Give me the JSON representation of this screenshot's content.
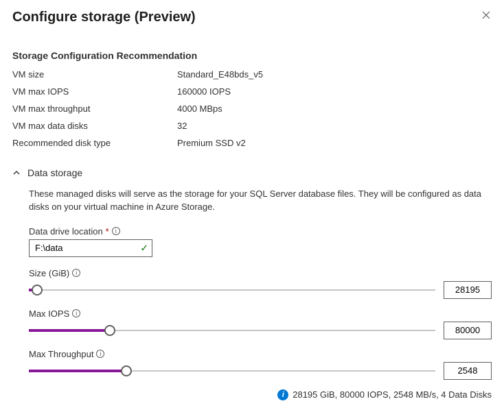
{
  "header": {
    "title": "Configure storage (Preview)"
  },
  "recommendation": {
    "heading": "Storage Configuration Recommendation",
    "rows": {
      "vm_size_label": "VM size",
      "vm_size_value": "Standard_E48bds_v5",
      "vm_max_iops_label": "VM max IOPS",
      "vm_max_iops_value": "160000 IOPS",
      "vm_max_throughput_label": "VM max throughput",
      "vm_max_throughput_value": "4000 MBps",
      "vm_max_data_disks_label": "VM max data disks",
      "vm_max_data_disks_value": "32",
      "recommended_disk_type_label": "Recommended disk type",
      "recommended_disk_type_value": "Premium SSD v2"
    }
  },
  "data_storage": {
    "title": "Data storage",
    "description": "These managed disks will serve as the storage for your SQL Server database files. They will be configured as data disks on your virtual machine in Azure Storage.",
    "drive_location_label": "Data drive location",
    "drive_location_value": "F:\\data",
    "size_label": "Size (GiB)",
    "size_value": "28195",
    "size_fill_pct": 2,
    "max_iops_label": "Max IOPS",
    "max_iops_value": "80000",
    "max_iops_fill_pct": 20,
    "max_throughput_label": "Max Throughput",
    "max_throughput_value": "2548",
    "max_throughput_fill_pct": 24
  },
  "footer": {
    "summary": "28195 GiB, 80000 IOPS, 2548 MB/s, 4 Data Disks"
  }
}
